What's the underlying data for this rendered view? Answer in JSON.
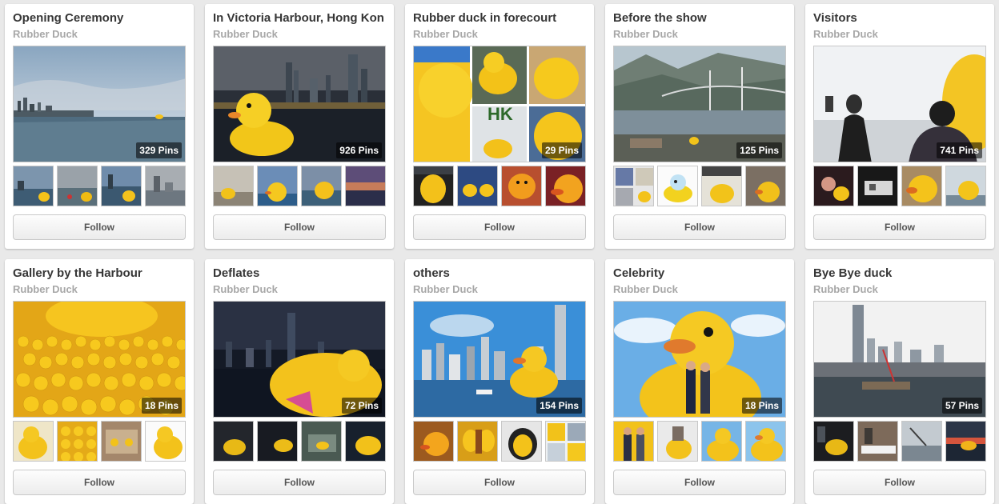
{
  "follow_label": "Follow",
  "boards": [
    {
      "title": "Opening Ceremony",
      "owner": "Rubber Duck",
      "pins": "329 Pins",
      "cover": "harbour-tiny-duck"
    },
    {
      "title": "In Victoria Harbour, Hong Kong",
      "owner": "Rubber Duck",
      "pins": "926 Pins",
      "cover": "night-duck"
    },
    {
      "title": "Rubber duck in forecourt",
      "owner": "Rubber Duck",
      "pins": "29 Pins",
      "cover": "collage-duck"
    },
    {
      "title": "Before the show",
      "owner": "Rubber Duck",
      "pins": "125 Pins",
      "cover": "bridge-mountains"
    },
    {
      "title": "Visitors",
      "owner": "Rubber Duck",
      "pins": "741 Pins",
      "cover": "visitors"
    },
    {
      "title": "Gallery by the Harbour",
      "owner": "Rubber Duck",
      "pins": "18 Pins",
      "cover": "many-ducks"
    },
    {
      "title": "Deflates",
      "owner": "Rubber Duck",
      "pins": "72 Pins",
      "cover": "deflated-duck"
    },
    {
      "title": "others",
      "owner": "Rubber Duck",
      "pins": "154 Pins",
      "cover": "skyline-duck"
    },
    {
      "title": "Celebrity",
      "owner": "Rubber Duck",
      "pins": "18 Pins",
      "cover": "duck-people"
    },
    {
      "title": "Bye Bye duck",
      "owner": "Rubber Duck",
      "pins": "57 Pins",
      "cover": "pier-skyline"
    }
  ]
}
